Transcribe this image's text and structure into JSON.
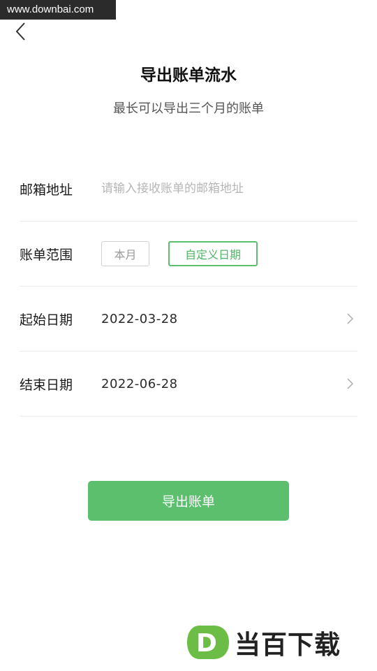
{
  "watermark": {
    "site": "www.downbai.com"
  },
  "header": {
    "back_icon": "chevron-left-icon",
    "title": "导出账单流水",
    "subtitle": "最长可以导出三个月的账单"
  },
  "form": {
    "email": {
      "label": "邮箱地址",
      "placeholder": "请输入接收账单的邮箱地址",
      "value": ""
    },
    "range": {
      "label": "账单范围",
      "options": [
        "本月",
        "自定义日期"
      ],
      "selected": "自定义日期"
    },
    "start": {
      "label": "起始日期",
      "value": "2022-03-28",
      "icon": "chevron-right-icon"
    },
    "end": {
      "label": "结束日期",
      "value": "2022-06-28",
      "icon": "chevron-right-icon"
    }
  },
  "action": {
    "export_label": "导出账单"
  },
  "brand": {
    "logo_text": "当百下载",
    "logo_letter": "D"
  },
  "colors": {
    "accent": "#5bbf6e",
    "accent_text": "#4fb666",
    "divider": "#ececec"
  }
}
